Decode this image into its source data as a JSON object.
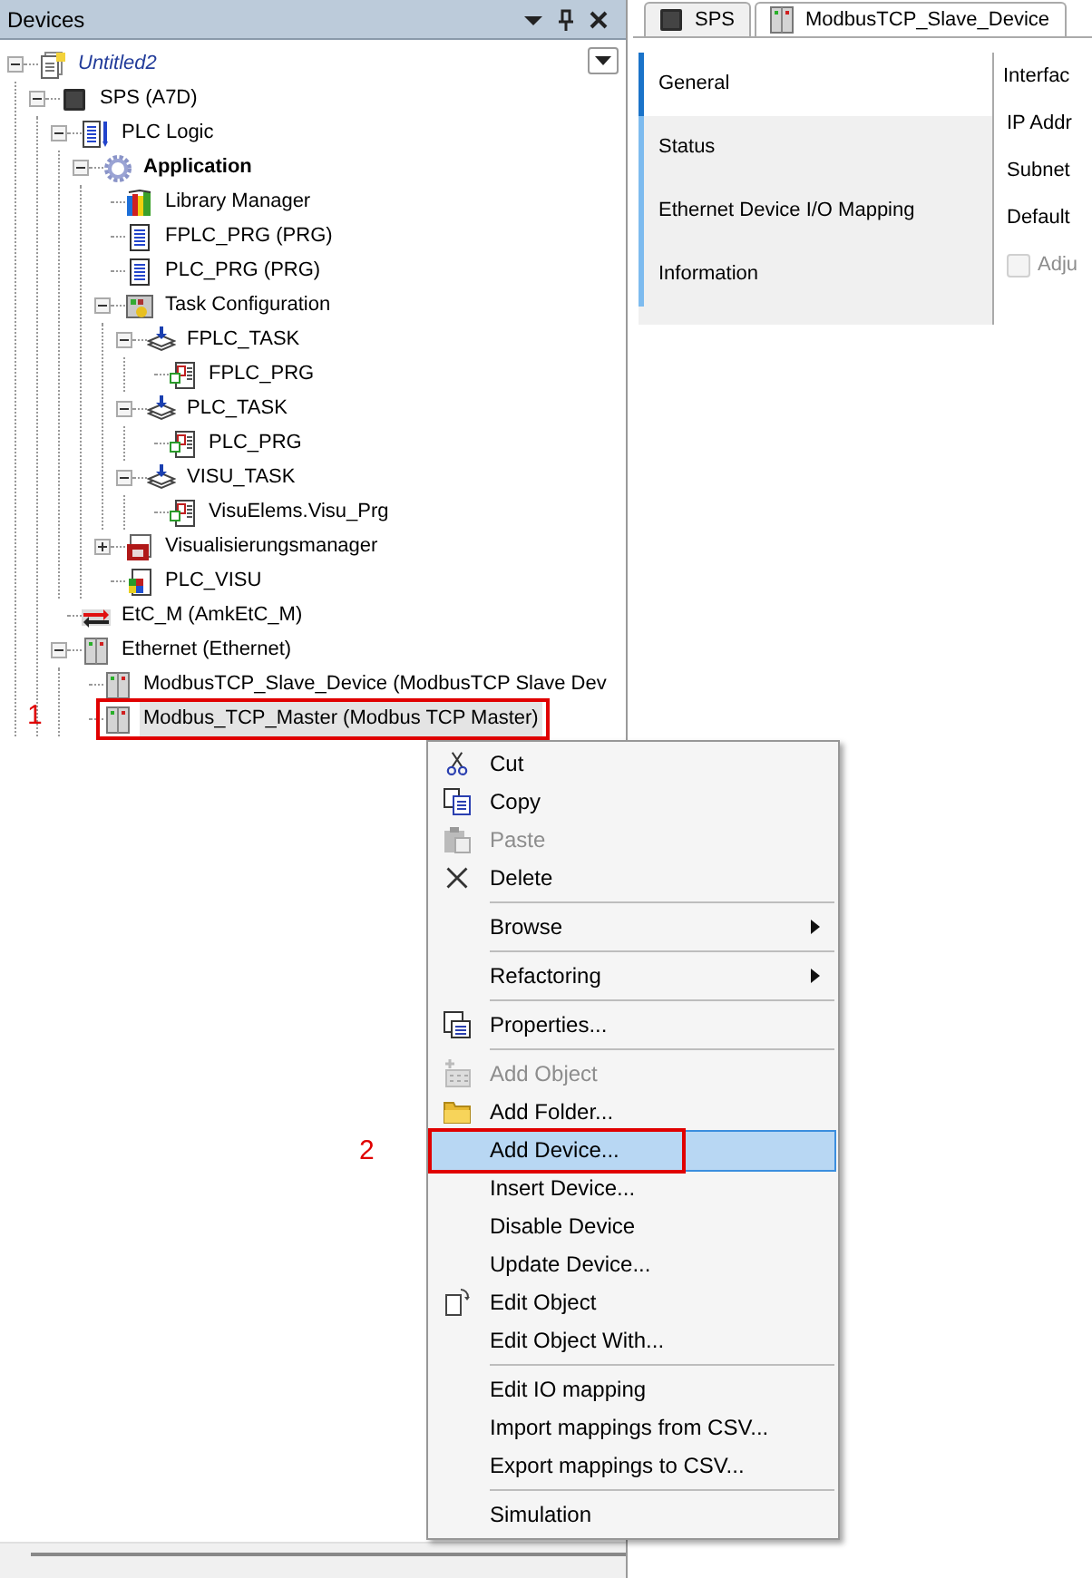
{
  "devices_panel": {
    "title": "Devices",
    "tree": [
      {
        "label": "Untitled2",
        "kind": "project",
        "expanded": true,
        "children": [
          {
            "label": "SPS (A7D)",
            "kind": "controller",
            "expanded": true,
            "children": [
              {
                "label": "PLC Logic",
                "kind": "plc-logic",
                "expanded": true,
                "children": [
                  {
                    "label": "Application",
                    "kind": "application",
                    "expanded": true,
                    "children": [
                      {
                        "label": "Library Manager",
                        "kind": "library"
                      },
                      {
                        "label": "FPLC_PRG (PRG)",
                        "kind": "pou"
                      },
                      {
                        "label": "PLC_PRG (PRG)",
                        "kind": "pou"
                      },
                      {
                        "label": "Task Configuration",
                        "kind": "task-config",
                        "expanded": true,
                        "children": [
                          {
                            "label": "FPLC_TASK",
                            "kind": "task",
                            "expanded": true,
                            "children": [
                              {
                                "label": "FPLC_PRG",
                                "kind": "program-call"
                              }
                            ]
                          },
                          {
                            "label": "PLC_TASK",
                            "kind": "task",
                            "expanded": true,
                            "children": [
                              {
                                "label": "PLC_PRG",
                                "kind": "program-call"
                              }
                            ]
                          },
                          {
                            "label": "VISU_TASK",
                            "kind": "task",
                            "expanded": true,
                            "children": [
                              {
                                "label": "VisuElems.Visu_Prg",
                                "kind": "program-call"
                              }
                            ]
                          }
                        ]
                      },
                      {
                        "label": "Visualisierungsmanager",
                        "kind": "visu-manager",
                        "expanded": false
                      },
                      {
                        "label": "PLC_VISU",
                        "kind": "visu"
                      }
                    ]
                  }
                ]
              },
              {
                "label": "EtC_M (AmkEtC_M)",
                "kind": "ethercat"
              },
              {
                "label": "Ethernet (Ethernet)",
                "kind": "device",
                "expanded": true,
                "children": [
                  {
                    "label": "ModbusTCP_Slave_Device (ModbusTCP Slave Dev",
                    "kind": "device"
                  },
                  {
                    "label": "Modbus_TCP_Master (Modbus TCP Master)",
                    "kind": "device",
                    "selected": true,
                    "marked": true
                  }
                ]
              }
            ]
          }
        ]
      }
    ]
  },
  "editor": {
    "tabs": [
      {
        "label": "SPS",
        "kind": "controller",
        "selected": false
      },
      {
        "label": "ModbusTCP_Slave_Device",
        "kind": "device",
        "selected": true
      }
    ],
    "side_tabs": [
      {
        "label": "General",
        "selected": true
      },
      {
        "label": "Status",
        "selected": false
      },
      {
        "label": "Ethernet Device I/O Mapping",
        "selected": false
      },
      {
        "label": "Information",
        "selected": false
      }
    ],
    "section_label": "Interfac",
    "fields": [
      "IP Addr",
      "Subnet",
      "Default"
    ],
    "checkbox": {
      "label": "Adju",
      "checked": false,
      "disabled": true
    }
  },
  "context_menu": [
    {
      "kind": "cut",
      "label": "Cut",
      "disabled": false
    },
    {
      "kind": "copy",
      "label": "Copy",
      "disabled": false
    },
    {
      "kind": "paste",
      "label": "Paste",
      "disabled": true
    },
    {
      "kind": "delete",
      "label": "Delete",
      "disabled": false
    },
    {
      "kind": "separator"
    },
    {
      "kind": "plain",
      "label": "Browse",
      "submenu": true,
      "disabled": false
    },
    {
      "kind": "separator"
    },
    {
      "kind": "plain",
      "label": "Refactoring",
      "submenu": true,
      "disabled": false
    },
    {
      "kind": "separator"
    },
    {
      "kind": "properties",
      "label": "Properties...",
      "disabled": false
    },
    {
      "kind": "separator"
    },
    {
      "kind": "add-object",
      "label": "Add Object",
      "disabled": true
    },
    {
      "kind": "folder",
      "label": "Add Folder...",
      "disabled": false
    },
    {
      "kind": "plain",
      "label": "Add Device...",
      "disabled": false,
      "selected": true,
      "marked": true
    },
    {
      "kind": "plain",
      "label": "Insert Device...",
      "disabled": false
    },
    {
      "kind": "plain",
      "label": "Disable Device",
      "disabled": false
    },
    {
      "kind": "plain",
      "label": "Update Device...",
      "disabled": false
    },
    {
      "kind": "edit-object",
      "label": "Edit Object",
      "disabled": false
    },
    {
      "kind": "plain",
      "label": "Edit Object With...",
      "disabled": false
    },
    {
      "kind": "separator"
    },
    {
      "kind": "plain",
      "label": "Edit IO mapping",
      "disabled": false
    },
    {
      "kind": "plain",
      "label": "Import mappings from CSV...",
      "disabled": false
    },
    {
      "kind": "plain",
      "label": "Export mappings to CSV...",
      "disabled": false
    },
    {
      "kind": "separator"
    },
    {
      "kind": "plain",
      "label": "Simulation",
      "disabled": false
    }
  ],
  "callouts": [
    {
      "label": "1"
    },
    {
      "label": "2"
    }
  ]
}
